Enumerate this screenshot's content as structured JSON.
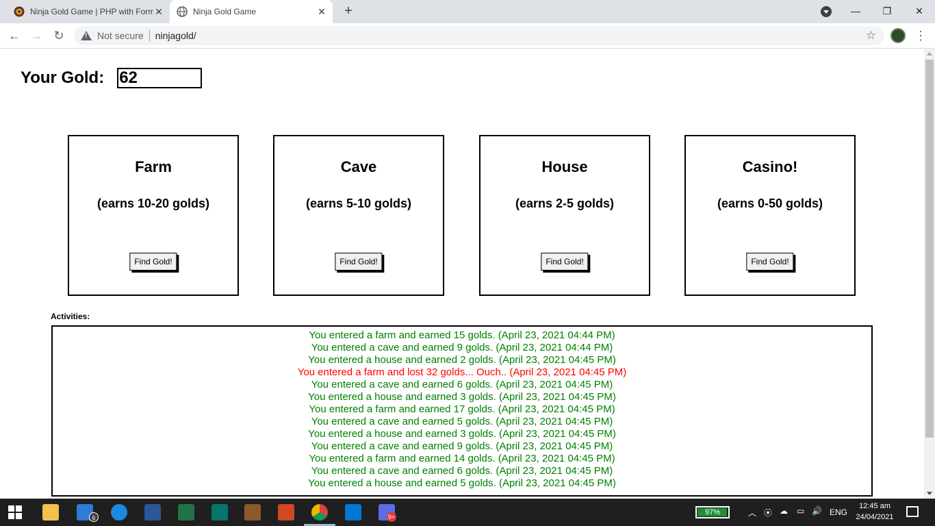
{
  "browser": {
    "tabs": [
      {
        "title": "Ninja Gold Game | PHP with Form",
        "active": false
      },
      {
        "title": "Ninja Gold Game",
        "active": true
      }
    ],
    "address": {
      "security_label": "Not secure",
      "url": "ninjagold/"
    }
  },
  "page": {
    "gold_label": "Your Gold:",
    "gold_value": "62",
    "locations": [
      {
        "name": "Farm",
        "earns": "(earns 10-20 golds)",
        "button": "Find Gold!"
      },
      {
        "name": "Cave",
        "earns": "(earns 5-10 golds)",
        "button": "Find Gold!"
      },
      {
        "name": "House",
        "earns": "(earns 2-5 golds)",
        "button": "Find Gold!"
      },
      {
        "name": "Casino!",
        "earns": "(earns 0-50 golds)",
        "button": "Find Gold!"
      }
    ],
    "activities_label": "Activities:",
    "activities": [
      {
        "text": "You entered a farm and earned 15 golds. (April 23, 2021 04:44 PM)",
        "type": "earn"
      },
      {
        "text": "You entered a cave and earned 9 golds. (April 23, 2021 04:44 PM)",
        "type": "earn"
      },
      {
        "text": "You entered a house and earned 2 golds. (April 23, 2021 04:45 PM)",
        "type": "earn"
      },
      {
        "text": "You entered a farm and lost 32 golds... Ouch.. (April 23, 2021 04:45 PM)",
        "type": "loss"
      },
      {
        "text": "You entered a cave and earned 6 golds. (April 23, 2021 04:45 PM)",
        "type": "earn"
      },
      {
        "text": "You entered a house and earned 3 golds. (April 23, 2021 04:45 PM)",
        "type": "earn"
      },
      {
        "text": "You entered a farm and earned 17 golds. (April 23, 2021 04:45 PM)",
        "type": "earn"
      },
      {
        "text": "You entered a cave and earned 5 golds. (April 23, 2021 04:45 PM)",
        "type": "earn"
      },
      {
        "text": "You entered a house and earned 3 golds. (April 23, 2021 04:45 PM)",
        "type": "earn"
      },
      {
        "text": "You entered a cave and earned 9 golds. (April 23, 2021 04:45 PM)",
        "type": "earn"
      },
      {
        "text": "You entered a farm and earned 14 golds. (April 23, 2021 04:45 PM)",
        "type": "earn"
      },
      {
        "text": "You entered a cave and earned 6 golds. (April 23, 2021 04:45 PM)",
        "type": "earn"
      },
      {
        "text": "You entered a house and earned 5 golds. (April 23, 2021 04:45 PM)",
        "type": "earn"
      }
    ],
    "colors": {
      "earn": "#008000",
      "loss": "#ff0000"
    }
  },
  "taskbar": {
    "mail_badge": "6",
    "chat_badge": "9+",
    "battery": "97%",
    "battery_level": 0.97,
    "language": "ENG",
    "time": "12:45 am",
    "date": "24/04/2021"
  }
}
